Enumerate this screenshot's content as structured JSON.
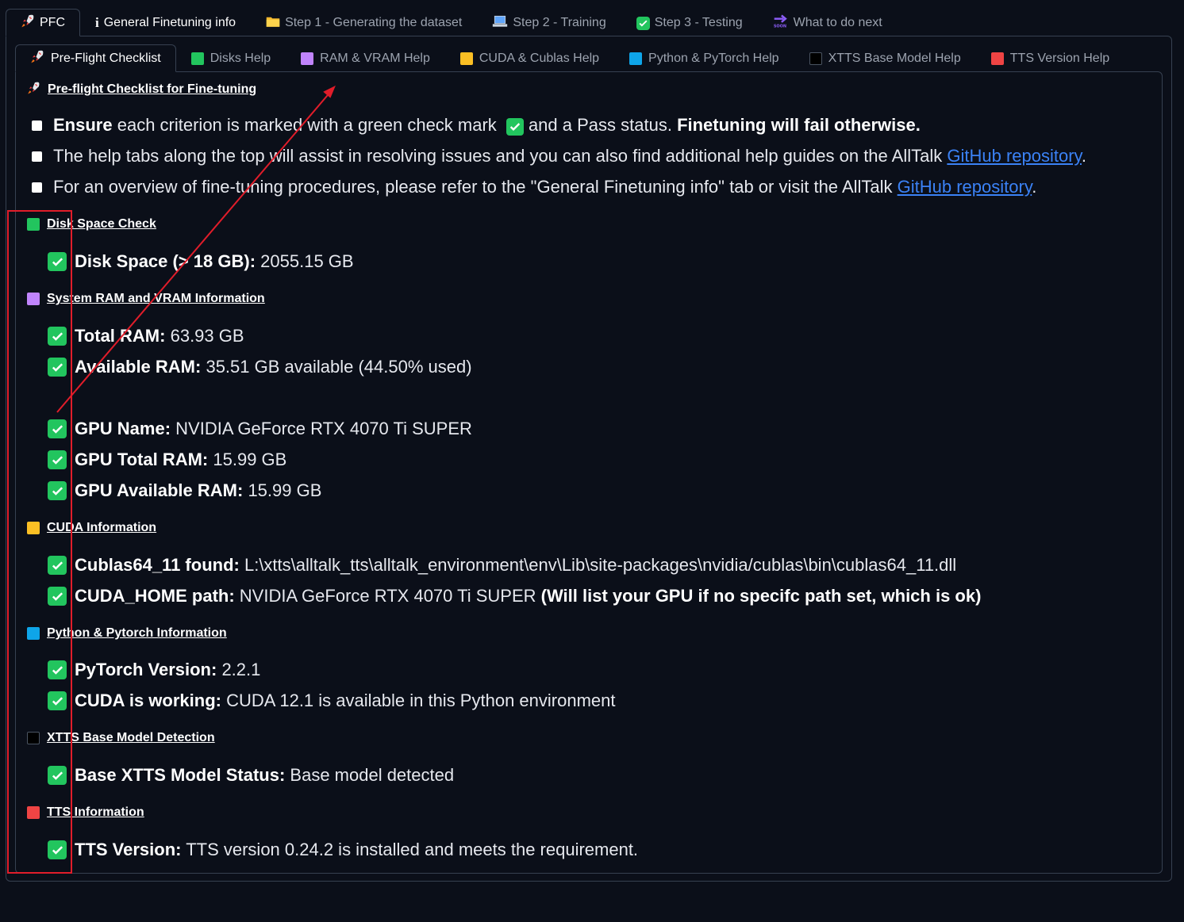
{
  "top_tabs": [
    {
      "icon": "rocket-icon",
      "label": "PFC",
      "active": true
    },
    {
      "icon": "info-icon",
      "label": "General Finetuning info",
      "active": false
    },
    {
      "icon": "folder-icon",
      "label": "Step 1 - Generating the dataset",
      "active": false
    },
    {
      "icon": "laptop-icon",
      "label": "Step 2 - Training",
      "active": false
    },
    {
      "icon": "check-icon",
      "label": "Step 3 - Testing",
      "active": false
    },
    {
      "icon": "soon-arrow-icon",
      "label": "What to do next",
      "active": false
    }
  ],
  "inner_tabs": [
    {
      "icon": "rocket-icon",
      "label": "Pre-Flight Checklist",
      "active": true,
      "color": ""
    },
    {
      "icon": "green-square-icon",
      "label": "Disks Help",
      "active": false,
      "color": "#22c55e"
    },
    {
      "icon": "purple-square-icon",
      "label": "RAM & VRAM Help",
      "active": false,
      "color": "#c084fc"
    },
    {
      "icon": "orange-square-icon",
      "label": "CUDA & Cublas Help",
      "active": false,
      "color": "#fbbf24"
    },
    {
      "icon": "blue-square-icon",
      "label": "Python & PyTorch Help",
      "active": false,
      "color": "#0ea5e9"
    },
    {
      "icon": "black-square-icon",
      "label": "XTTS Base Model Help",
      "active": false,
      "color": "#000000"
    },
    {
      "icon": "red-square-icon",
      "label": "TTS Version Help",
      "active": false,
      "color": "#ef4444"
    }
  ],
  "checklist": {
    "title": "Pre-flight Checklist for Fine-tuning",
    "bullets": {
      "b1_strong": "Ensure",
      "b1_text1": "each criterion is marked with a green check mark",
      "b1_text2": "and a Pass status.",
      "b1_strong2": "Finetuning will fail otherwise.",
      "b2_text": "The help tabs along the top will assist in resolving issues and you can also find additional help guides on the AllTalk",
      "b2_link": "GitHub repository",
      "b3_text": "For an overview of fine-tuning procedures, please refer to the \"General Finetuning info\" tab or visit the AllTalk",
      "b3_link": "GitHub repository"
    }
  },
  "sections": {
    "disk": {
      "title": "Disk Space Check",
      "color": "#22c55e",
      "disk_label": "Disk Space (> 18 GB):",
      "disk_value": "2055.15 GB"
    },
    "ram": {
      "title": "System RAM and VRAM Information",
      "color": "#c084fc",
      "total_label": "Total RAM:",
      "total_value": "63.93 GB",
      "avail_label": "Available RAM:",
      "avail_value": "35.51 GB available (44.50% used)",
      "gpu_name_label": "GPU Name:",
      "gpu_name_value": "NVIDIA GeForce RTX 4070 Ti SUPER",
      "gpu_total_label": "GPU Total RAM:",
      "gpu_total_value": "15.99 GB",
      "gpu_avail_label": "GPU Available RAM:",
      "gpu_avail_value": "15.99 GB"
    },
    "cuda": {
      "title": "CUDA Information",
      "color": "#fbbf24",
      "cublas_label": "Cublas64_11 found:",
      "cublas_value": "L:\\xtts\\alltalk_tts\\alltalk_environment\\env\\Lib\\site-packages\\nvidia/cublas\\bin\\cublas64_11.dll",
      "home_label": "CUDA_HOME path:",
      "home_value": "NVIDIA GeForce RTX 4070 Ti SUPER",
      "home_note": "(Will list your GPU if no specifc path set, which is ok)"
    },
    "python": {
      "title": "Python & Pytorch Information",
      "color": "#0ea5e9",
      "torch_label": "PyTorch Version:",
      "torch_value": "2.2.1",
      "cuda_label": "CUDA is working:",
      "cuda_value": "CUDA 12.1 is available in this Python environment"
    },
    "xtts": {
      "title": "XTTS Base Model Detection",
      "color": "#000000",
      "status_label": "Base XTTS Model Status:",
      "status_value": "Base model detected"
    },
    "tts": {
      "title": "TTS Information",
      "color": "#ef4444",
      "version_label": "TTS Version:",
      "version_value": "TTS version 0.24.2 is installed and meets the requirement."
    }
  },
  "annotation_color": "#e11d2a"
}
